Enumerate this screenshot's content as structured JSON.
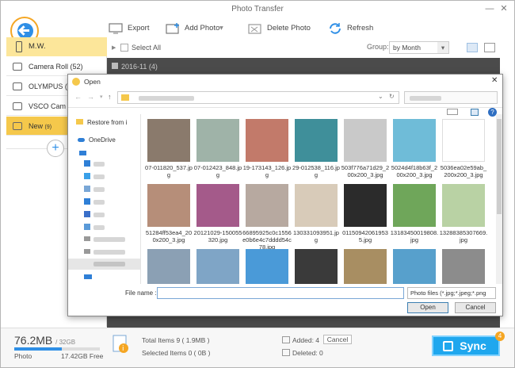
{
  "window": {
    "title": "Photo Transfer"
  },
  "toolbar": {
    "export": "Export",
    "add_photo": "Add Photo",
    "delete_photo": "Delete Photo",
    "refresh": "Refresh"
  },
  "sidebar": {
    "device": "M.W.",
    "albums": [
      {
        "label": "Camera Roll",
        "count": "(52)"
      },
      {
        "label": "OLYMPUS",
        "count": "(4"
      },
      {
        "label": "VSCO Cam",
        "count": "("
      },
      {
        "label": "New",
        "count": "(9)"
      }
    ]
  },
  "main": {
    "select_all": "Select All",
    "group_label": "Group:",
    "group_value": "by Month",
    "date_header": "2016-11",
    "date_count": "(4)"
  },
  "dialog": {
    "title": "Open",
    "nav_items": [
      "Restore from i",
      "OneDrive"
    ],
    "files": [
      {
        "name": "07-011820_537.jpg",
        "color": "#8a7a6c"
      },
      {
        "name": "07-012423_848.jpg",
        "color": "#9fb3a8"
      },
      {
        "name": "19-173143_126.jpg",
        "color": "#c27a6a"
      },
      {
        "name": "29-012538_116.jpg",
        "color": "#3f8f9a"
      },
      {
        "name": "503f776a71d29_200x200_3.jpg",
        "color": "#c9c9c9"
      },
      {
        "name": "5024d4f18b63f_200x200_3.jpg",
        "color": "#6fbcd8"
      },
      {
        "name": "5036ea02e59ab_200x200_3.jpg",
        "color": "#ffffff"
      },
      {
        "name": "51284ff53ea4_200x200_3.jpg",
        "color": "#b68e79"
      },
      {
        "name": "20121029-150055320.jpg",
        "color": "#a45a8a"
      },
      {
        "name": "66895925c0c1556e0b6e4c7dddd54c78.jpg",
        "color": "#b7a9a0"
      },
      {
        "name": "130331093951.jpg",
        "color": "#d8cbb9"
      },
      {
        "name": "011509420619535.jpg",
        "color": "#2b2b2b"
      },
      {
        "name": "13183450019808.jpg",
        "color": "#6fa65a"
      },
      {
        "name": "13288385307669.jpg",
        "color": "#b9d2a4"
      },
      {
        "name": "",
        "color": "#8ba0b4"
      },
      {
        "name": "",
        "color": "#7fa5c6"
      },
      {
        "name": "",
        "color": "#4a9ad8"
      },
      {
        "name": "",
        "color": "#3a3a3a"
      },
      {
        "name": "",
        "color": "#a88e62"
      },
      {
        "name": "",
        "color": "#57a0cc"
      },
      {
        "name": "",
        "color": "#8c8c8c"
      }
    ],
    "filename_label": "File name :",
    "filename_value": "",
    "filetype": "Photo files (*.jpg;*.jpeg;*.png",
    "open": "Open",
    "cancel": "Cancel"
  },
  "footer": {
    "storage": "76.2MB",
    "storage_total": "/ 32GB",
    "storage_type": "Photo",
    "free": "17.42GB Free",
    "total_items": "Total Items 9 ( 1.9MB )",
    "selected_items": "Selected Items 0 ( 0B )",
    "added": "Added: 4",
    "deleted": "Deleted: 0",
    "cancel": "Cancel",
    "sync": "Sync",
    "sync_badge": "4"
  }
}
